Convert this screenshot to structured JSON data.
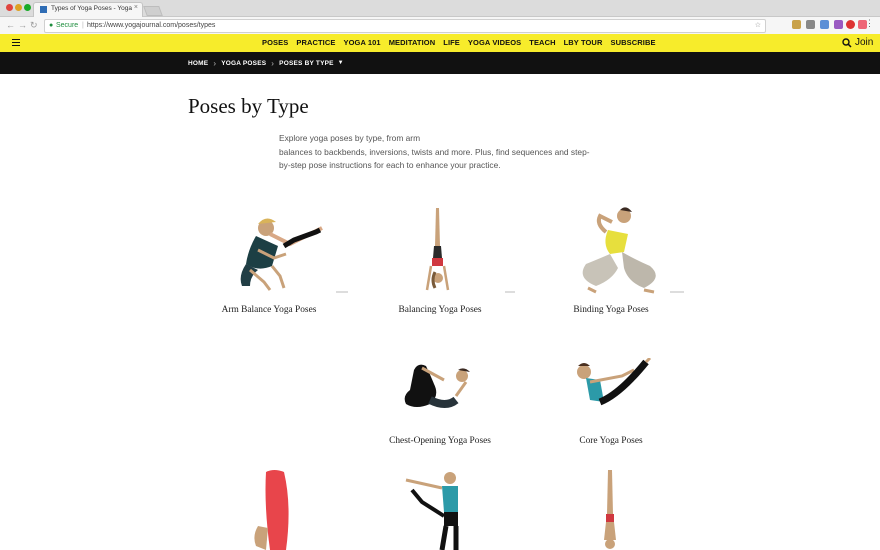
{
  "browser": {
    "tab_title": "Types of Yoga Poses - Yoga",
    "tab_close": "×",
    "profile_name": "",
    "secure_label": "Secure",
    "url": "https://www.yogajournal.com/poses/types"
  },
  "site": {
    "menu": [
      "POSES",
      "PRACTICE",
      "YOGA 101",
      "MEDITATION",
      "LIFE",
      "YOGA VIDEOS",
      "TEACH",
      "LBY TOUR",
      "SUBSCRIBE"
    ],
    "join_label": "Join",
    "accent_color": "#f7ec2b"
  },
  "breadcrumb": [
    "HOME",
    "YOGA POSES",
    "POSES BY TYPE"
  ],
  "page": {
    "title": "Poses by Type",
    "intro_lines": [
      "Explore yoga poses by type, from arm",
      "balances to backbends, inversions, twists and more. Plus, find sequences and step-",
      "by-step pose instructions for each to enhance your practice."
    ]
  },
  "pose_types": [
    {
      "label": "Arm Balance Yoga Poses",
      "icon": "arm-balance-figure"
    },
    {
      "label": "Balancing Yoga Poses",
      "icon": "handstand-figure"
    },
    {
      "label": "Binding Yoga Poses",
      "icon": "binding-figure"
    },
    {
      "label": "Chest-Opening Yoga Poses",
      "icon": "bow-pose-figure"
    },
    {
      "label": "Core Yoga Poses",
      "icon": "boat-pose-figure"
    },
    {
      "label": "",
      "icon": "forward-fold-figure"
    },
    {
      "label": "",
      "icon": "standing-balance-figure"
    },
    {
      "label": "",
      "icon": "headstand-figure"
    }
  ]
}
